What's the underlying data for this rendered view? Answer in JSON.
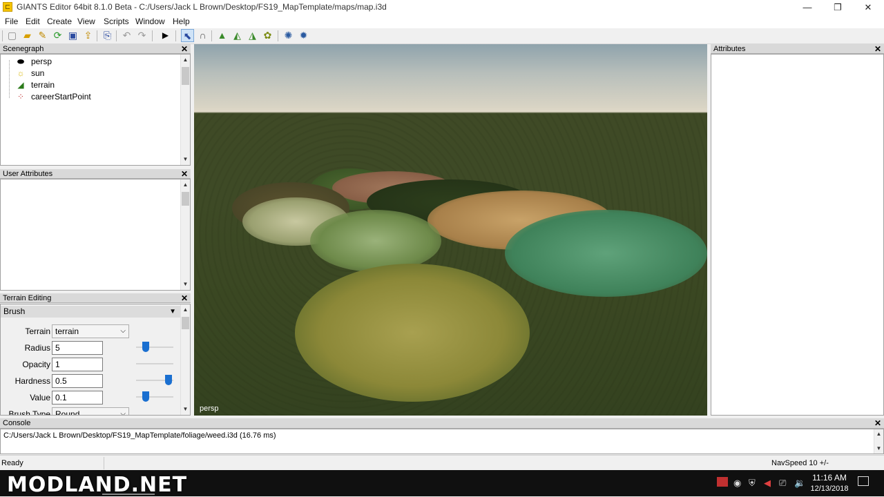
{
  "window": {
    "title": "GIANTS Editor 64bit 8.1.0 Beta - C:/Users/Jack L Brown/Desktop/FS19_MapTemplate/maps/map.i3d",
    "minimize": "—",
    "maximize": "❐",
    "close": "✕"
  },
  "menu": [
    "File",
    "Edit",
    "Create",
    "View",
    "Scripts",
    "Window",
    "Help"
  ],
  "scenegraph": {
    "title": "Scenegraph",
    "items": [
      {
        "label": "persp",
        "icon": "camera-icon"
      },
      {
        "label": "sun",
        "icon": "light-icon"
      },
      {
        "label": "terrain",
        "icon": "terrain-icon"
      },
      {
        "label": "careerStartPoint",
        "icon": "transform-group-icon"
      }
    ]
  },
  "user_attributes": {
    "title": "User Attributes"
  },
  "terrain_editing": {
    "title": "Terrain Editing",
    "section": "Brush",
    "fields": [
      {
        "label": "Terrain",
        "value": "terrain"
      },
      {
        "label": "Radius",
        "value": "5"
      },
      {
        "label": "Opacity",
        "value": "1"
      },
      {
        "label": "Hardness",
        "value": "0.5"
      },
      {
        "label": "Value",
        "value": "0.1"
      },
      {
        "label": "Brush Type",
        "value": "Round"
      }
    ]
  },
  "attributes": {
    "title": "Attributes"
  },
  "viewport": {
    "camera_label": "persp"
  },
  "console": {
    "title": "Console",
    "message": "C:/Users/Jack L Brown/Desktop/FS19_MapTemplate/foliage/weed.i3d (16.76 ms)"
  },
  "status": {
    "left": "Ready",
    "navspeed": "NavSpeed 10 +/-"
  },
  "taskbar": {
    "time": "11:16 AM",
    "date": "12/13/2018"
  },
  "watermark": "MODLAND.NET",
  "colors": {
    "slider_accent": "#1a6fd0",
    "panel_header": "#d9d9d9"
  }
}
